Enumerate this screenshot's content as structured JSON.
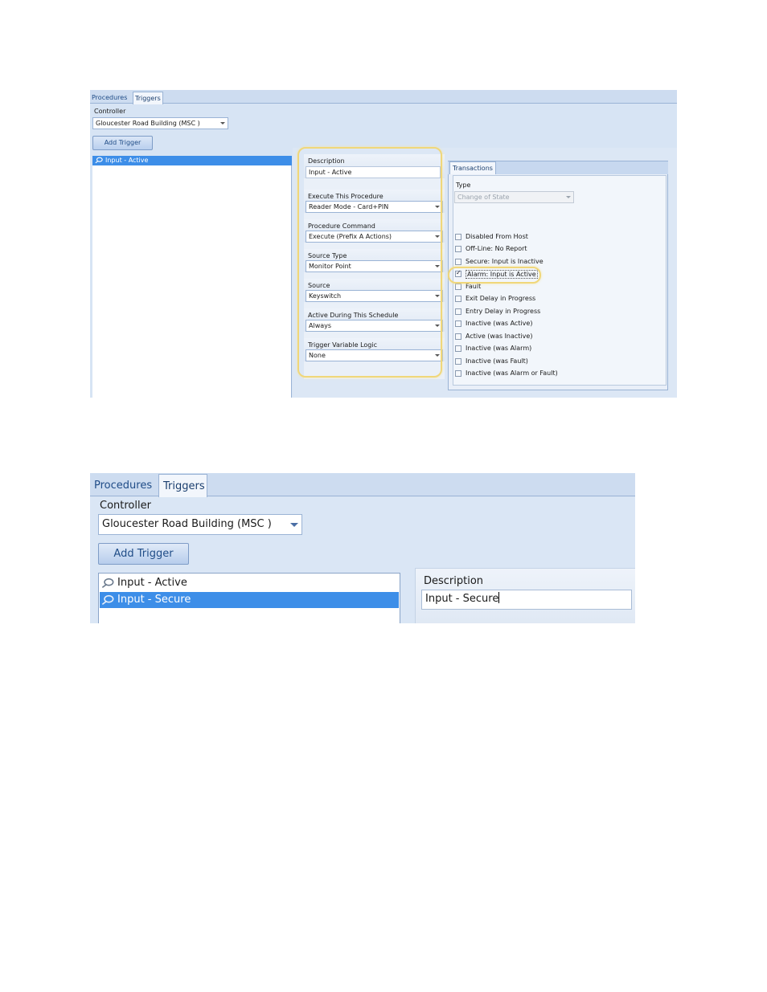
{
  "screenshot1": {
    "tabs": [
      {
        "label": "Procedures",
        "selected": false
      },
      {
        "label": "Triggers",
        "selected": true
      }
    ],
    "controller_label": "Controller",
    "controller_value": "Gloucester Road Building (MSC )",
    "add_trigger_label": "Add Trigger",
    "trigger_list": [
      "Input - Active"
    ],
    "fields": [
      {
        "label": "Description",
        "value": "Input - Active",
        "dropdown": false
      },
      {
        "label": "Execute This Procedure",
        "value": "Reader Mode - Card+PIN",
        "dropdown": true
      },
      {
        "label": "Procedure Command",
        "value": "Execute (Prefix A Actions)",
        "dropdown": true
      },
      {
        "label": "Source Type",
        "value": "Monitor Point",
        "dropdown": true
      },
      {
        "label": "Source",
        "value": "Keyswitch",
        "dropdown": true
      },
      {
        "label": "Active During This Schedule",
        "value": "Always",
        "dropdown": true
      },
      {
        "label": "Trigger Variable Logic",
        "value": "None",
        "dropdown": true
      }
    ],
    "transactions_tab": "Transactions",
    "type_label": "Type",
    "type_value": "Change of State",
    "checkboxes": [
      {
        "label": "Disabled From Host",
        "checked": false
      },
      {
        "label": "Off-Line: No Report",
        "checked": false
      },
      {
        "label": "Secure: Input is Inactive",
        "checked": false
      },
      {
        "label": "Alarm: Input is Active",
        "checked": true
      },
      {
        "label": "Fault",
        "checked": false
      },
      {
        "label": "Exit Delay in Progress",
        "checked": false
      },
      {
        "label": "Entry Delay in Progress",
        "checked": false
      },
      {
        "label": "Inactive (was Active)",
        "checked": false
      },
      {
        "label": "Active (was Inactive)",
        "checked": false
      },
      {
        "label": "Inactive (was Alarm)",
        "checked": false
      },
      {
        "label": "Inactive (was Fault)",
        "checked": false
      },
      {
        "label": "Inactive (was Alarm or Fault)",
        "checked": false
      }
    ],
    "colors": {
      "highlight": "#f0d77a",
      "selection": "#3d8ee8"
    }
  },
  "screenshot2": {
    "tabs": [
      {
        "label": "Procedures",
        "selected": false
      },
      {
        "label": "Triggers",
        "selected": true
      }
    ],
    "controller_label": "Controller",
    "controller_value": "Gloucester Road Building (MSC )",
    "add_trigger_label": "Add Trigger",
    "trigger_list": [
      {
        "label": "Input - Active",
        "selected": false
      },
      {
        "label": "Input - Secure",
        "selected": true
      }
    ],
    "description_label": "Description",
    "description_value": "Input - Secure"
  }
}
